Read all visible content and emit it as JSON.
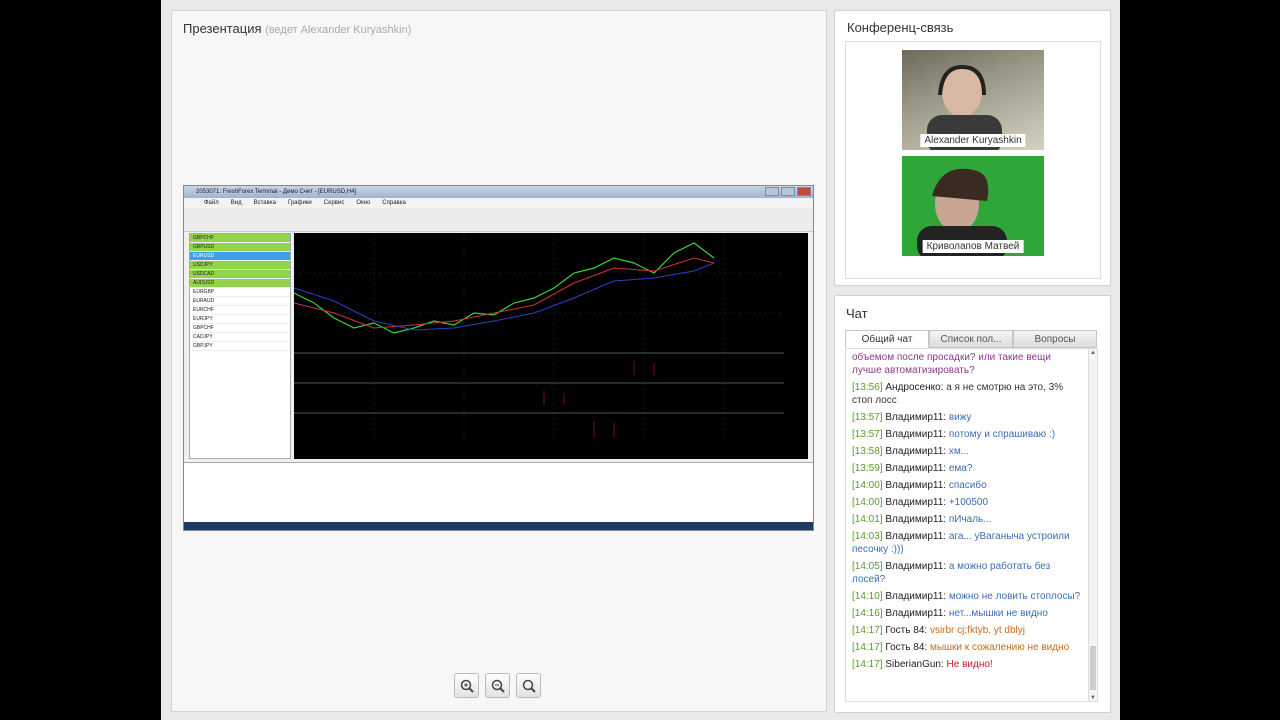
{
  "presentation": {
    "title": "Презентация",
    "host": "(ведет Alexander Kuryashkin)",
    "terminal": {
      "window_title": "2053071: FreshForex Terminal - Демо Счет - [EURUSD,H4]",
      "menu": [
        "Файл",
        "Вид",
        "Вставка",
        "Графики",
        "Сервис",
        "Окно",
        "Справка"
      ],
      "symbols": [
        "GBPCHF",
        "GBPUSD",
        "EURUSD",
        "USDJPY",
        "USDCAD",
        "AUDUSD",
        "EURGBP",
        "EURAUD",
        "EURCHF",
        "EURJPY",
        "GBPCHF",
        "CADJPY",
        "GBPJPY"
      ]
    }
  },
  "conference": {
    "title": "Конференц-связь",
    "participants": [
      {
        "name": "Alexander Kuryashkin"
      },
      {
        "name": "Криволапов Матвей"
      }
    ]
  },
  "chat": {
    "title": "Чат",
    "tabs": [
      "Общий чат",
      "Список пол...",
      "Вопросы"
    ],
    "messages": [
      {
        "ts": "",
        "who": "",
        "text": "объемом после просадки? или такие вещи лучше автоматизировать?",
        "color": "purple"
      },
      {
        "ts": "[13:56]",
        "who": "Андросенко:",
        "text": "а я не смотрю на это, 3% стоп лосс",
        "color": "dark"
      },
      {
        "ts": "[13:57]",
        "who": "Владимир11:",
        "text": "вижу",
        "color": "blue"
      },
      {
        "ts": "[13:57]",
        "who": "Владимир11:",
        "text": "потому и спрашиваю :)",
        "color": "blue"
      },
      {
        "ts": "[13:58]",
        "who": "Владимир11:",
        "text": "хм...",
        "color": "blue"
      },
      {
        "ts": "[13:59]",
        "who": "Владимир11:",
        "text": "ема?",
        "color": "blue"
      },
      {
        "ts": "[14:00]",
        "who": "Владимир11:",
        "text": "спасибо",
        "color": "blue"
      },
      {
        "ts": "[14:00]",
        "who": "Владимир11:",
        "text": "+100500",
        "color": "blue"
      },
      {
        "ts": "[14:01]",
        "who": "Владимир11:",
        "text": "пИчаль...",
        "color": "blue"
      },
      {
        "ts": "[14:03]",
        "who": "Владимир11:",
        "text": "ага... уВаганыча устроили песочку :)))",
        "color": "blue"
      },
      {
        "ts": "[14:05]",
        "who": "Владимир11:",
        "text": "а можно работать без лосей?",
        "color": "blue"
      },
      {
        "ts": "[14:10]",
        "who": "Владимир11:",
        "text": "можно не ловить стоплосы?",
        "color": "blue"
      },
      {
        "ts": "[14:16]",
        "who": "Владимир11:",
        "text": "нет...мышки не видно",
        "color": "blue"
      },
      {
        "ts": "[14:17]",
        "who": "Гость 84:",
        "text": "vsirbr cj;fktyb, yt dblyj",
        "color": "orange"
      },
      {
        "ts": "[14:17]",
        "who": "Гость 84:",
        "text": "мышки к сожалению не видно",
        "color": "orange"
      },
      {
        "ts": "[14:17]",
        "who": "SiberianGun:",
        "text": "Не видно!",
        "color": "red"
      }
    ]
  },
  "colors": {
    "accent_green": "#5a9a2c",
    "msg_blue": "#3a6fb2",
    "msg_orange": "#c96a1b",
    "msg_red": "#cc1f1f"
  }
}
